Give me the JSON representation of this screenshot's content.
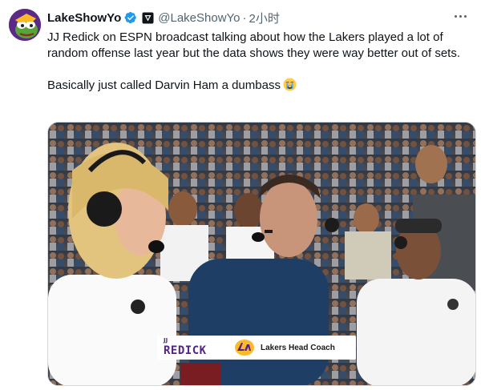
{
  "tweet": {
    "display_name": "LakeShowYo",
    "handle": "@LakeShowYo",
    "separator": "·",
    "time": "2小时",
    "text_line1": "JJ Redick on ESPN broadcast talking about how the Lakers played a lot of random offense last year but the data shows they were way better out of sets.",
    "text_line2": "Basically just called Darvin Ham a dumbass",
    "emoji": "loudly-crying-face"
  },
  "media": {
    "lower_third": {
      "first_name": "JJ",
      "last_name": "REDICK",
      "title": "Lakers Head Coach"
    }
  },
  "colors": {
    "lakers_purple": "#552583",
    "lakers_gold": "#fdb927",
    "verified_blue": "#1d9bf0",
    "secondary_text": "#536471"
  },
  "icons": [
    "verified-badge-icon",
    "affiliate-badge-icon",
    "more-options-icon",
    "lakers-logo-icon"
  ]
}
